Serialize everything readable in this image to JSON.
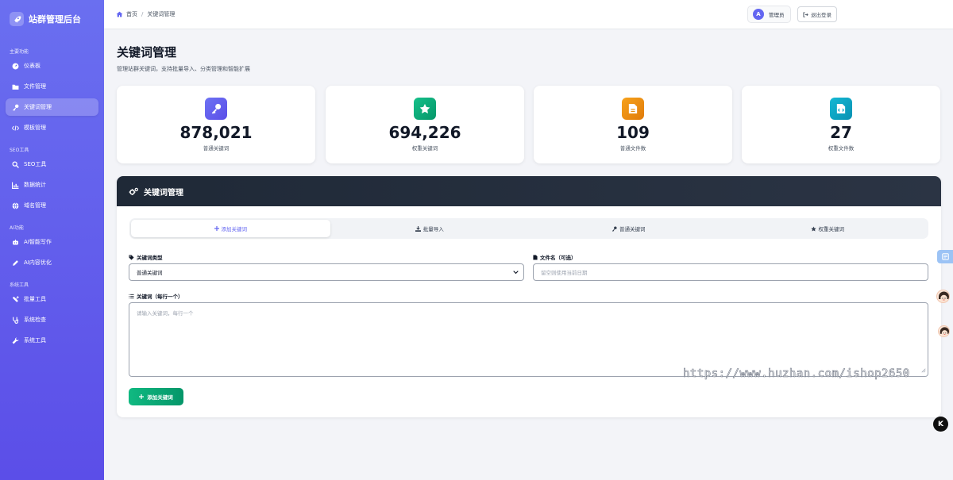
{
  "sidebar": {
    "brand": "站群管理后台",
    "sections": {
      "main": "主要功能",
      "seo": "SEO工具",
      "ai": "AI功能",
      "system": "系统工具"
    },
    "items": [
      {
        "label": "仪表板",
        "icon": "dashboard-icon"
      },
      {
        "label": "文件管理",
        "icon": "folder-icon"
      },
      {
        "label": "关键词管理",
        "icon": "key-icon",
        "active": true
      },
      {
        "label": "模板管理",
        "icon": "code-icon"
      },
      {
        "label": "SEO工具",
        "icon": "search-icon"
      },
      {
        "label": "数据统计",
        "icon": "bar-chart-icon"
      },
      {
        "label": "域名管理",
        "icon": "globe-icon"
      },
      {
        "label": "AI智能写作",
        "icon": "robot-icon"
      },
      {
        "label": "AI内容优化",
        "icon": "pen-icon"
      },
      {
        "label": "批量工具",
        "icon": "tools-icon"
      },
      {
        "label": "系统检查",
        "icon": "stethoscope-icon"
      },
      {
        "label": "系统工具",
        "icon": "wrench-icon"
      }
    ]
  },
  "header": {
    "breadcrumb": {
      "home": "首页",
      "separator": "/",
      "current": "关键词管理"
    },
    "user": {
      "avatar_letter": "A",
      "name": "管理员"
    },
    "logout_label": "退出登录"
  },
  "page": {
    "title": "关键词管理",
    "subtitle": "管理站群关键词，支持批量导入、分类管理和智能扩展"
  },
  "stats": [
    {
      "value": "878,021",
      "label": "普通关键词",
      "icon": "key-icon",
      "color": "#6366f1"
    },
    {
      "value": "694,226",
      "label": "权重关键词",
      "icon": "star-icon",
      "color": "#10b981"
    },
    {
      "value": "109",
      "label": "普通文件数",
      "icon": "file-icon",
      "color": "#f59e0b"
    },
    {
      "value": "27",
      "label": "权重文件数",
      "icon": "file-code-icon",
      "color": "#06b6d4"
    }
  ],
  "panel": {
    "title": "关键词管理",
    "tabs": [
      {
        "label": "添加关键词",
        "icon": "plus-icon",
        "active": true
      },
      {
        "label": "批量导入",
        "icon": "download-icon"
      },
      {
        "label": "普通关键词",
        "icon": "key-icon"
      },
      {
        "label": "权重关键词",
        "icon": "star-icon"
      }
    ],
    "form": {
      "type_label": "关键词类型",
      "type_value": "普通关键词",
      "filename_label": "文件名（可选）",
      "filename_placeholder": "留空则使用当前日期",
      "keywords_label": "关键词（每行一个）",
      "keywords_placeholder": "请输入关键词，每行一个",
      "submit_label": "添加关键词"
    }
  },
  "watermark": "https://www.huzhan.com/ishop2650",
  "float_k": "K",
  "colors": {
    "accent": "#6366f1",
    "success": "#10b981",
    "sidebar_top": "#6a6ff0",
    "sidebar_bottom": "#5b4ee8"
  }
}
